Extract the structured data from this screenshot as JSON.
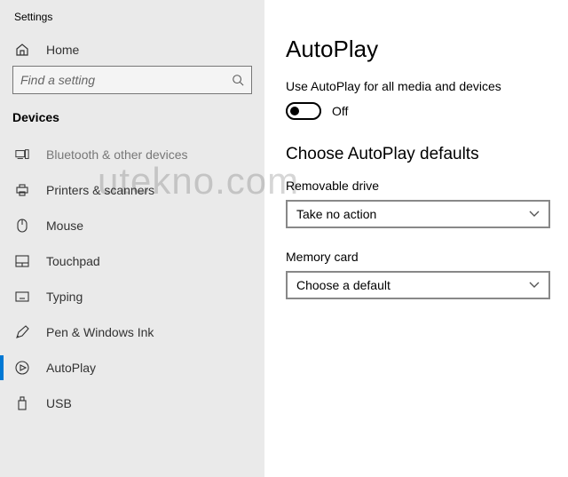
{
  "window": {
    "title": "Settings"
  },
  "sidebar": {
    "home": "Home",
    "search": {
      "placeholder": "Find a setting"
    },
    "section": "Devices",
    "items": [
      {
        "label": "Bluetooth & other devices"
      },
      {
        "label": "Printers & scanners"
      },
      {
        "label": "Mouse"
      },
      {
        "label": "Touchpad"
      },
      {
        "label": "Typing"
      },
      {
        "label": "Pen & Windows Ink"
      },
      {
        "label": "AutoPlay"
      },
      {
        "label": "USB"
      }
    ]
  },
  "main": {
    "title": "AutoPlay",
    "toggle": {
      "description": "Use AutoPlay for all media and devices",
      "state_label": "Off"
    },
    "defaults": {
      "heading": "Choose AutoPlay defaults",
      "removable": {
        "label": "Removable drive",
        "value": "Take no action"
      },
      "memorycard": {
        "label": "Memory card",
        "value": "Choose a default"
      }
    }
  },
  "watermark": "utekno.com"
}
